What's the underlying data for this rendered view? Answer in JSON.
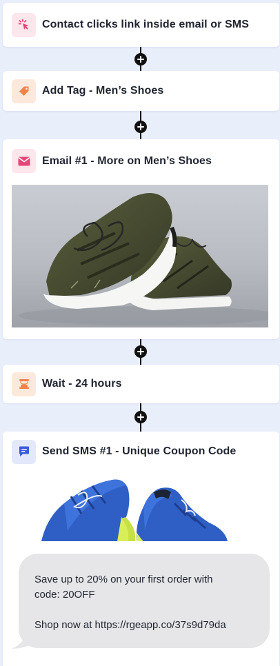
{
  "steps": {
    "trigger": {
      "title": "Contact clicks link inside email or SMS",
      "icon": "sparkle-click-icon",
      "accent": "#e8437a"
    },
    "tag": {
      "title": "Add Tag - Men’s Shoes",
      "icon": "tag-icon",
      "accent": "#f0824a"
    },
    "email": {
      "title": "Email #1 - More on Men’s Shoes",
      "icon": "envelope-icon",
      "accent": "#e8437a",
      "image": "olive-sneakers-photo"
    },
    "wait": {
      "title": "Wait - 24 hours",
      "icon": "hourglass-icon",
      "accent": "#f0824a"
    },
    "sms": {
      "title": "Send SMS #1 - Unique Coupon Code",
      "icon": "chat-bubble-icon",
      "accent": "#3d5bd9",
      "image": "blue-sneakers-photo",
      "message_line1": "Save up to 20% on your first order with",
      "message_line2": "code: 20OFF",
      "message_line3": "Shop now at https://rgeapp.co/37s9d79da"
    }
  },
  "colors": {
    "canvas": "#e9eefb",
    "card": "#ffffff",
    "connector": "#111111",
    "bubble": "#e6e6e8"
  }
}
